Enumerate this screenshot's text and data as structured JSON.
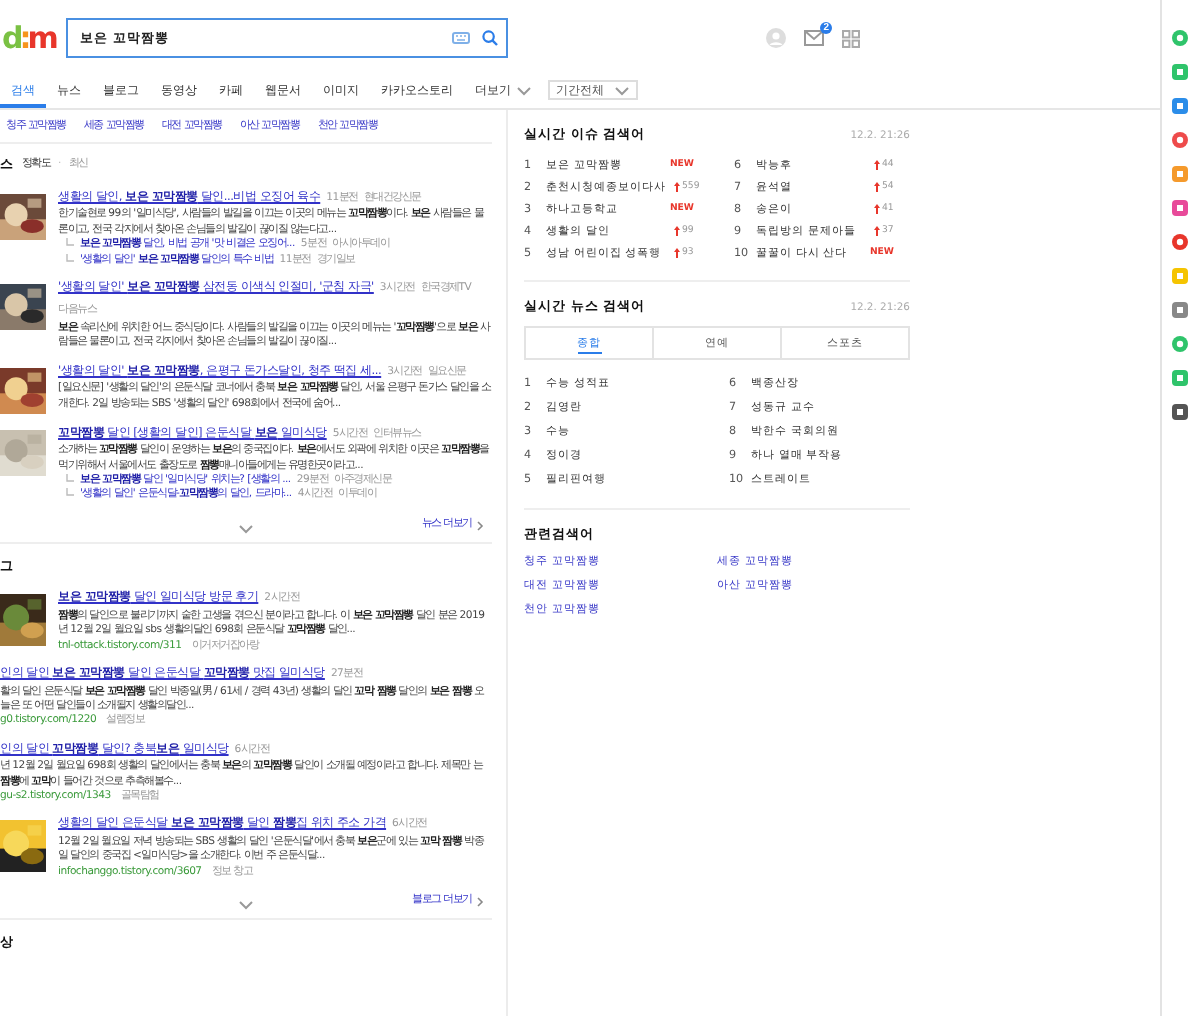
{
  "header": {
    "logo": "d:m",
    "search": {
      "value": "보은 꼬막짬뽕"
    },
    "mail_badge": "2"
  },
  "nav": {
    "tabs": [
      {
        "label": "검색",
        "selected": true
      },
      {
        "label": "뉴스",
        "selected": false
      },
      {
        "label": "블로그",
        "selected": false
      },
      {
        "label": "동영상",
        "selected": false
      },
      {
        "label": "카페",
        "selected": false
      },
      {
        "label": "웹문서",
        "selected": false
      },
      {
        "label": "이미지",
        "selected": false
      },
      {
        "label": "카카오스토리",
        "selected": false
      },
      {
        "label": "더보기",
        "selected": false
      }
    ],
    "period": "기간전체"
  },
  "related_top": [
    "청주 꼬막짬뽕",
    "세종 꼬막짬뽕",
    "대전 꼬막짬뽕",
    "아산 꼬막짬뽕",
    "천안 꼬막짬뽕"
  ],
  "news": {
    "label": "스",
    "separator": "·",
    "sort": [
      {
        "label": "정확도",
        "selected": true
      },
      {
        "label": "최신",
        "selected": false
      }
    ],
    "items": [
      {
        "thumb": true,
        "title": "생활의 달인, **보은 꼬막짬뽕** 달인...비법 오징어 육수",
        "time": "11분전",
        "sources": [
          "현대건강신문"
        ],
        "desc": "한기술현로 99의 '일미식당', 사람들의 발길을 이끄는 이곳의 메뉴는 **꼬막짬뽕**이다. **보은** 사람들은 물론이고, 전국 각지에서 찾아온 손님들의 발길이 끊이질 않는다고...",
        "related": [
          {
            "title": "**보은 꼬막짬뽕** 달인, 비법 공개 '맛 비결은 오징어...",
            "time": "5분전",
            "source": "아시아투데이"
          },
          {
            "title": "'생활의 달인' **보은 꼬막짬뽕** 달인의 특수 비법",
            "time": "11분전",
            "source": "경기일보"
          }
        ]
      },
      {
        "thumb": true,
        "title": "'생활의 달인' **보은 꼬막짬뽕** 삼전동 이색식 인절미, '군침 자극'",
        "time": "3시간전",
        "sources": [
          "한국경제TV",
          "다음뉴스"
        ],
        "desc": "**보은** 속리산에 위치한 어느 중식당이다. 사람들의 발길을 이끄는 이곳의 메뉴는 '**꼬막짬뽕**'으로 **보은** 사람들은 물론이고, 전국 각지에서 찾아온 손님들의 발길이 끊이질..."
      },
      {
        "thumb": true,
        "title": "'생활의 달인' **보은 꼬막짬뽕**, 은평구 돈가스달인, 청주 떡집 세...",
        "time": "3시간전",
        "sources": [
          "일요신문"
        ],
        "desc": "[일요신문] '생활의 달인'의 은둔식달 코너에서 충북 **보은 꼬막짬뽕** 달인, 서울 은평구 돈가스 달인을 소개한다. 2일 방송되는 SBS '생활의 달인' 698회에서 전국에 숨어..."
      },
      {
        "thumb": true,
        "title": "**꼬막짬뽕** 달인 [생활의 달인] 은둔식달 **보은** 일미식당",
        "time": "5시간전",
        "sources": [
          "인터뷰뉴스"
        ],
        "desc": "소개하는 **꼬막짬뽕** 달인이 운영하는 **보은**의 중국집이다. **보은**에서도 외곽에 위치한 이곳은 **꼬막짬뽕**을 먹기위해서 서울에서도 출장도로 **짬뽕**매니아들에게는 유명한곳이라고...",
        "related": [
          {
            "title": "**보은 꼬막짬뽕** 달인 '일미식당' 위치는? [생활의 ...",
            "time": "29분전",
            "source": "아주경제신문"
          },
          {
            "title": "'생활의 달인' 은둔식달-**꼬막짬뽕**의 달인, 드라마...",
            "time": "4시간전",
            "source": "이투데이"
          }
        ]
      }
    ],
    "more": "뉴스 더보기"
  },
  "blog": {
    "label": "그",
    "items": [
      {
        "thumb": true,
        "title": "**보은 꼬막짬뽕** 달인 일미식당 방문 후기",
        "time": "2시간전",
        "desc": "**짬뽕**의 달인으로 불리기까지 숱한 고생을 겪으신 분이라고 합니다. 이 **보은 꼬막짬뽕** 달인 분은 2019년 12월 2일 월요일 sbs 생활의달인 698회 은둔식달 **꼬막짬뽕** 달인...",
        "url": "tnl-ottack.tistory.com/311",
        "source": "이거저거잡아랑"
      },
      {
        "thumb": false,
        "title": "인의 달인 **보은 꼬막짬뽕** 달인 은둔식달 **꼬막짬뽕** 맛집 일미식당",
        "time": "27분전",
        "desc": "활의 달인 은둔식달 **보은 꼬막짬뽕** 달인 박종일(男 / 61세 / 경력 43년) 생활의 달인 **꼬막 짬뽕** 달인의 **보은 짬뽕** 오늘은 또 어떤 달인들이 소개될지 생활의달인...",
        "url": "g0.tistory.com/1220",
        "source": "설렘정보"
      },
      {
        "thumb": false,
        "title": "인의 달인 **꼬막짬뽕** 달인? 충북**보은** 일미식당",
        "time": "6시간전",
        "desc": "년 12월 2일 월요일 698회 생활의 달인에서는 충북 **보은**의 **꼬막짬뽕** 달인이 소개될 예정이라고 합니다. 제목만 는 **짬뽕**에 **꼬막**이 들어간 것으로 추측해볼수...",
        "url": "gu-s2.tistory.com/1343",
        "source": "골목탐험"
      },
      {
        "thumb": true,
        "title": "생활의 달인 은둔식달 **보은 꼬막짬뽕** 달인 **짬뽕**집 위치 주소 가격",
        "time": "6시간전",
        "desc": "12월 2일 월요일 저녁 방송되는 SBS 생활의 달인 '은둔식달'에서 충북 **보은**군에 있는 **꼬막 짬뽕** 박종일 달인의 중국집 <일미식당>을 소개한다. 이번 주 은둔식달...",
        "url": "infochanggo.tistory.com/3607",
        "source": "정보 창고"
      }
    ],
    "more": "블로그 더보기"
  },
  "next_label": "상",
  "issues": {
    "title": "실시간 이슈 검색어",
    "time": "12.2. 21:26",
    "items": [
      {
        "rank": "1",
        "label": "보은 꼬막짬뽕",
        "trend": {
          "kind": "new",
          "text": "NEW"
        }
      },
      {
        "rank": "2",
        "label": "춘천시청예종보이다사",
        "trend": {
          "kind": "up",
          "text": "559"
        }
      },
      {
        "rank": "3",
        "label": "하나고등학교",
        "trend": {
          "kind": "new",
          "text": "NEW"
        }
      },
      {
        "rank": "4",
        "label": "생활의 달인",
        "trend": {
          "kind": "up",
          "text": "99"
        }
      },
      {
        "rank": "5",
        "label": "성남 어린이집 성폭행",
        "trend": {
          "kind": "up",
          "text": "93"
        }
      },
      {
        "rank": "6",
        "label": "박능후",
        "trend": {
          "kind": "up",
          "text": "44"
        }
      },
      {
        "rank": "7",
        "label": "윤석열",
        "trend": {
          "kind": "up",
          "text": "54"
        }
      },
      {
        "rank": "8",
        "label": "송은이",
        "trend": {
          "kind": "up",
          "text": "41"
        }
      },
      {
        "rank": "9",
        "label": "독립방의 문제아들",
        "trend": {
          "kind": "up",
          "text": "37"
        }
      },
      {
        "rank": "10",
        "label": "꿀꿀이 다시 산다",
        "trend": {
          "kind": "new",
          "text": "NEW"
        }
      }
    ]
  },
  "news_keywords": {
    "title": "실시간 뉴스 검색어",
    "time": "12.2. 21:26",
    "tabs": [
      {
        "label": "종합",
        "selected": true
      },
      {
        "label": "연예",
        "selected": false
      },
      {
        "label": "스포츠",
        "selected": false
      }
    ],
    "items": [
      {
        "rank": "1",
        "label": "수능 성적표"
      },
      {
        "rank": "2",
        "label": "김영란"
      },
      {
        "rank": "3",
        "label": "수능"
      },
      {
        "rank": "4",
        "label": "정이경"
      },
      {
        "rank": "5",
        "label": "필리핀여행"
      },
      {
        "rank": "6",
        "label": "백종산장"
      },
      {
        "rank": "7",
        "label": "성동규 교수"
      },
      {
        "rank": "8",
        "label": "박한수 국회의원"
      },
      {
        "rank": "9",
        "label": "하나 열매 부작용"
      },
      {
        "rank": "10",
        "label": "스트레이트"
      }
    ]
  },
  "related": {
    "title": "관련검색어",
    "items": [
      "청주 꼬막짬뽕",
      "세종 꼬막짬뽕",
      "대전 꼬막짬뽕",
      "아산 꼬막짬뽕",
      "천안 꼬막짬뽕"
    ]
  }
}
